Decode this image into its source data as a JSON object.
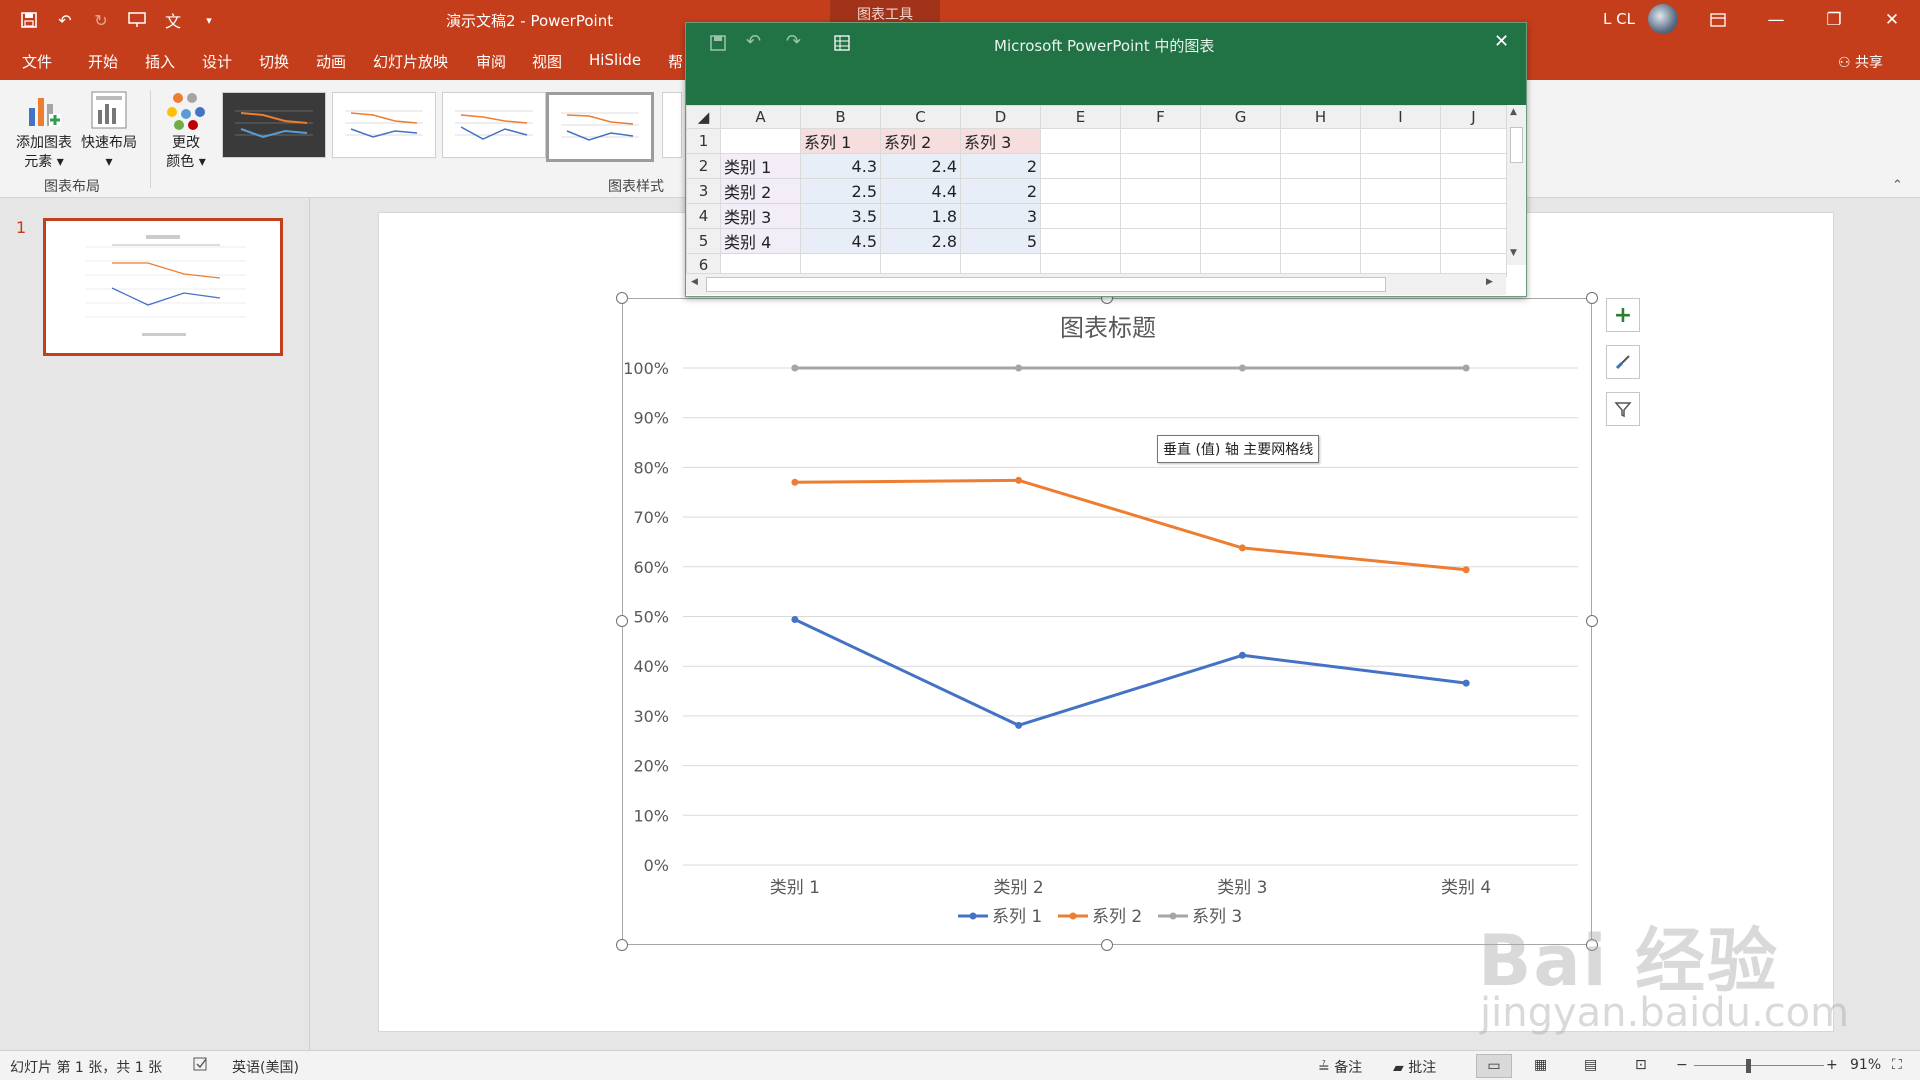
{
  "window": {
    "title": "演示文稿2  -  PowerPoint",
    "context_tab": "图表工具",
    "user_name": "L CL"
  },
  "ribbon_tabs": [
    "文件",
    "开始",
    "插入",
    "设计",
    "切换",
    "动画",
    "幻灯片放映",
    "审阅",
    "视图",
    "HiSlide",
    "帮"
  ],
  "share_label": "共享",
  "ribbon": {
    "add_element": [
      "添加图表",
      "元素 ▾"
    ],
    "quick_layout": [
      "快速布局",
      "▾"
    ],
    "change_colors": [
      "更改",
      "颜色 ▾"
    ],
    "group_layout": "图表布局",
    "group_styles": "图表样式"
  },
  "slide_pane": {
    "slide_number": "1"
  },
  "datasheet": {
    "title": "Microsoft PowerPoint 中的图表",
    "columns": [
      "A",
      "B",
      "C",
      "D",
      "E",
      "F",
      "G",
      "H",
      "I",
      "J"
    ],
    "rows": [
      {
        "n": "1",
        "cells": [
          "",
          "系列 1",
          "系列 2",
          "系列 3"
        ]
      },
      {
        "n": "2",
        "cells": [
          "类别 1",
          "4.3",
          "2.4",
          "2"
        ]
      },
      {
        "n": "3",
        "cells": [
          "类别 2",
          "2.5",
          "4.4",
          "2"
        ]
      },
      {
        "n": "4",
        "cells": [
          "类别 3",
          "3.5",
          "1.8",
          "3"
        ]
      },
      {
        "n": "5",
        "cells": [
          "类别 4",
          "4.5",
          "2.8",
          "5"
        ]
      },
      {
        "n": "6",
        "cells": [
          "",
          "",
          "",
          ""
        ]
      }
    ]
  },
  "chart_data": {
    "type": "line",
    "title": "图表标题",
    "categories": [
      "类别 1",
      "类别 2",
      "类别 3",
      "类别 4"
    ],
    "series": [
      {
        "name": "系列 1",
        "color": "#4472c4",
        "values": [
          49.4,
          28.1,
          42.2,
          36.6
        ]
      },
      {
        "name": "系列 2",
        "color": "#ed7d31",
        "values": [
          77.0,
          77.4,
          63.8,
          59.4
        ]
      },
      {
        "name": "系列 3",
        "color": "#a5a5a5",
        "values": [
          100,
          100,
          100,
          100
        ]
      }
    ],
    "y_ticks": [
      "0%",
      "10%",
      "20%",
      "30%",
      "40%",
      "50%",
      "60%",
      "70%",
      "80%",
      "90%",
      "100%"
    ],
    "ylim": [
      0,
      100
    ],
    "grid": true,
    "legend": "bottom"
  },
  "tooltip": "垂直 (值) 轴 主要网格线",
  "statusbar": {
    "slide_info": "幻灯片 第 1 张，共 1 张",
    "language": "英语(美国)",
    "notes": "备注",
    "comments": "批注",
    "zoom": "91%"
  },
  "watermark": {
    "brand": "Bai 经验",
    "url": "jingyan.baidu.com"
  }
}
